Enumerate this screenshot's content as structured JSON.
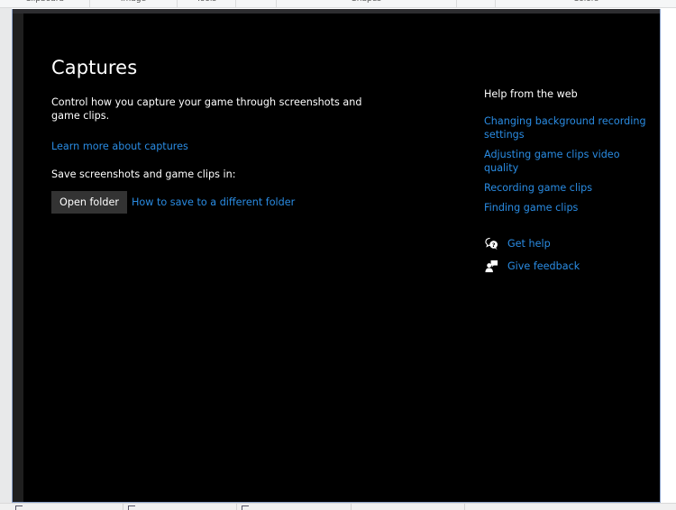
{
  "background_app": {
    "ribbon_groups": [
      "Clipboard",
      "Image",
      "Tools",
      "Shapes",
      "Colors"
    ]
  },
  "window": {
    "controls": {
      "minimize_icon": "minimize-icon",
      "maximize_icon": "maximize-icon",
      "close_icon": "close-icon"
    }
  },
  "page": {
    "title": "Captures",
    "description": "Control how you capture your game through screenshots and game clips.",
    "learn_more_link": "Learn more about captures",
    "save_label": "Save screenshots and game clips in:",
    "open_folder_button": "Open folder",
    "how_to_save_link": "How to save to a different folder"
  },
  "help": {
    "heading": "Help from the web",
    "links": [
      "Changing background recording settings",
      "Adjusting game clips video quality",
      "Recording game clips",
      "Finding game clips"
    ]
  },
  "support": {
    "get_help": {
      "label": "Get help",
      "icon": "get-help-icon"
    },
    "give_feedback": {
      "label": "Give feedback",
      "icon": "feedback-icon"
    }
  },
  "colors": {
    "background": "#000000",
    "link": "#2a8ce3",
    "button_bg": "#333333",
    "text": "#ffffff"
  }
}
